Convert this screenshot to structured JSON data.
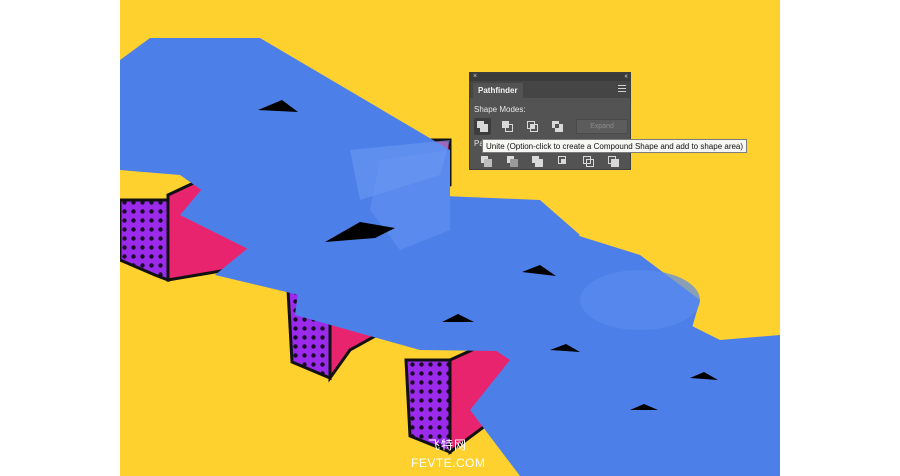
{
  "panel": {
    "close_glyph": "×",
    "collapse_glyph": "‹‹",
    "tab_title": "Pathfinder",
    "shape_modes_label": "Shape Modes:",
    "pathfinders_label": "Pa",
    "expand_label": "Expand",
    "shape_mode_buttons": [
      "unite",
      "minus-front",
      "intersect",
      "exclude"
    ],
    "pathfinder_buttons": [
      "divide",
      "trim",
      "merge",
      "crop",
      "outline",
      "minus-back"
    ]
  },
  "tooltip": {
    "text": "Unite (Option-click to create a Compound Shape and add to shape area)"
  },
  "watermark": {
    "chinese": "飞特网",
    "domain": "FEVTE.COM"
  },
  "colors": {
    "canvas_background": "#FFD12E",
    "letter_face": "#4D7FE8",
    "letter_side": "#E8246E",
    "halftone_base": "#9B2AEB",
    "outline": "#111111",
    "panel_bg": "#535353"
  }
}
